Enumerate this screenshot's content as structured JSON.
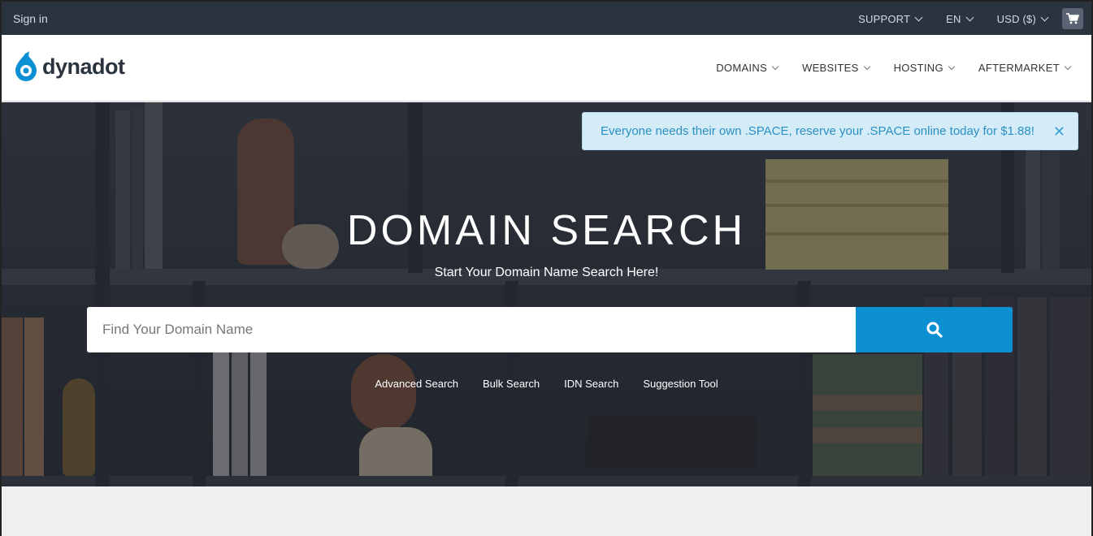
{
  "topbar": {
    "signin": "Sign in",
    "support": "SUPPORT",
    "language": "EN",
    "currency": "USD ($)",
    "cart_icon": "cart-icon"
  },
  "brand": {
    "name": "dynadot",
    "logo_icon": "dynadot-drop-logo",
    "color": "#0d8fd4"
  },
  "nav": {
    "items": [
      {
        "label": "DOMAINS"
      },
      {
        "label": "WEBSITES"
      },
      {
        "label": "HOSTING"
      },
      {
        "label": "AFTERMARKET"
      }
    ]
  },
  "alert": {
    "message": "Everyone needs their own .SPACE, reserve your .SPACE online today for $1.88!",
    "close_icon": "close-icon"
  },
  "hero": {
    "title": "DOMAIN SEARCH",
    "subtitle": "Start Your Domain Name Search Here!",
    "search_placeholder": "Find Your Domain Name",
    "search_icon": "search-icon",
    "links": [
      {
        "label": "Advanced Search"
      },
      {
        "label": "Bulk Search"
      },
      {
        "label": "IDN Search"
      },
      {
        "label": "Suggestion Tool"
      }
    ]
  },
  "colors": {
    "topbar_bg": "#2b333f",
    "accent": "#0d8fd4",
    "alert_bg": "#d4ecf7",
    "alert_text": "#2a8fc4"
  }
}
